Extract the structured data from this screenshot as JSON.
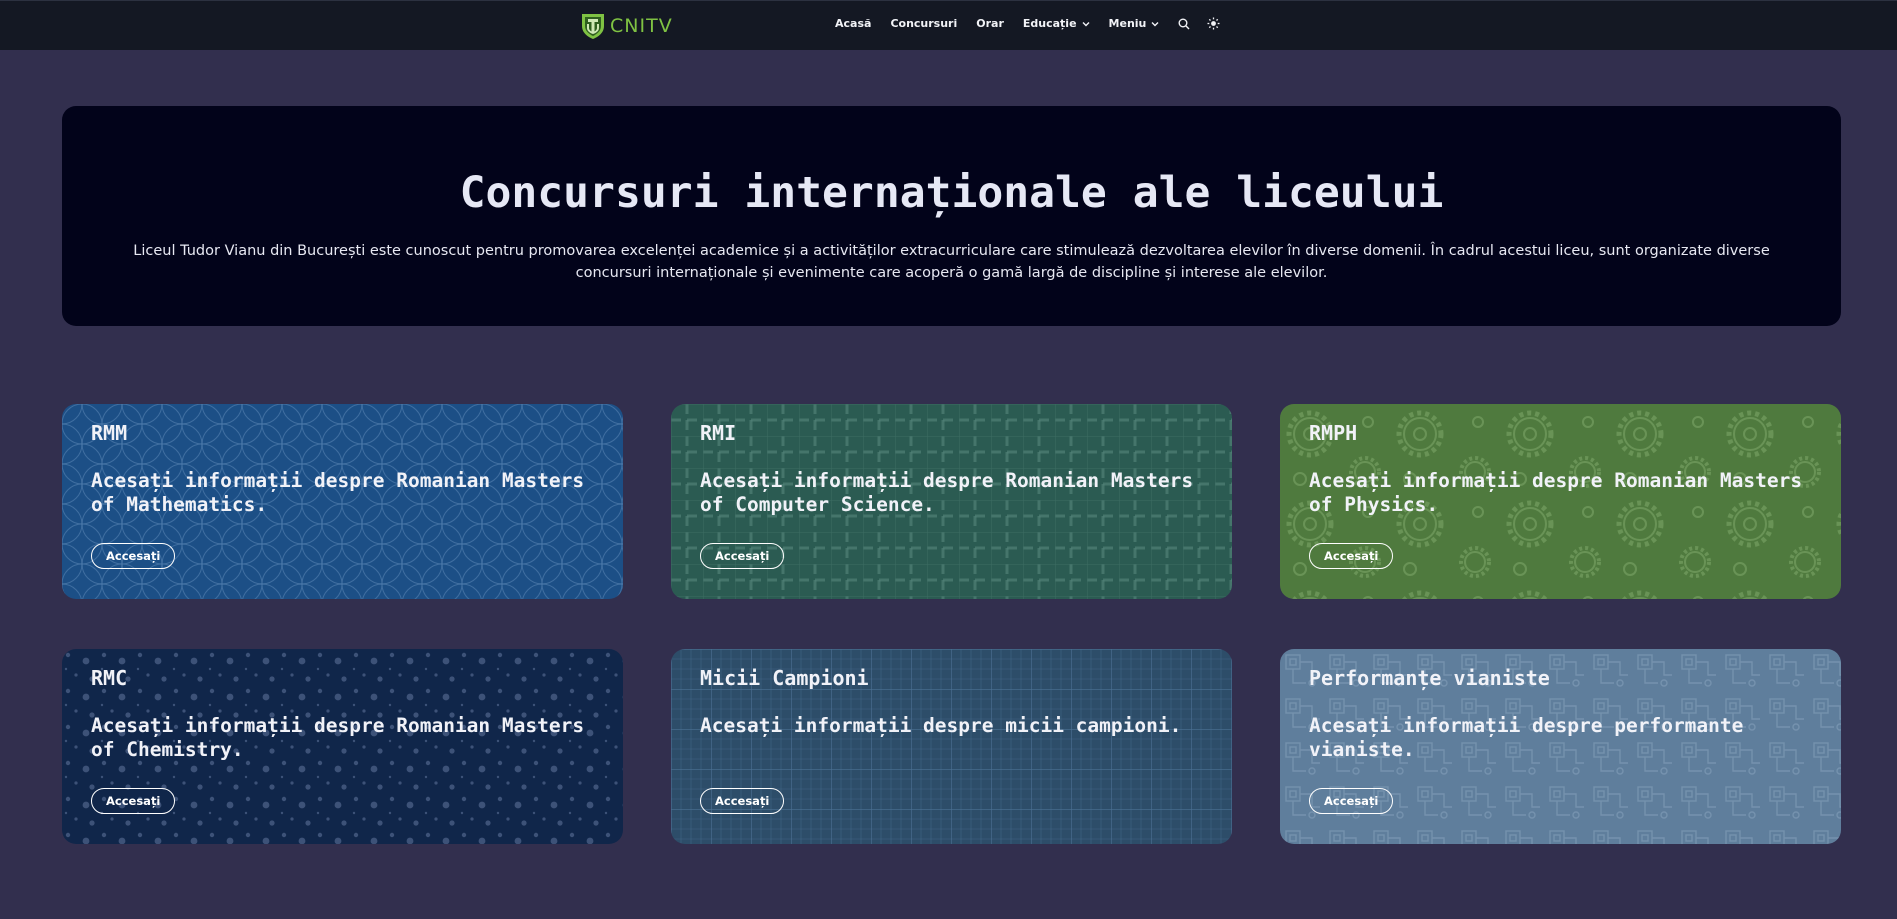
{
  "header": {
    "logo_text": "CNITV",
    "brand_color": "#7fc243",
    "nav": [
      {
        "label": "Acasă"
      },
      {
        "label": "Concursuri"
      },
      {
        "label": "Orar"
      },
      {
        "label": "Educație",
        "has_dropdown": true
      },
      {
        "label": "Meniu",
        "has_dropdown": true
      }
    ],
    "icons": [
      "search-icon",
      "theme-toggle-icon"
    ]
  },
  "hero": {
    "title": "Concursuri internaționale ale liceului",
    "description": "Liceul Tudor Vianu din București este cunoscut pentru promovarea excelenței academice și a activităților extracurriculare care stimulează dezvoltarea elevilor în diverse domenii. În cadrul acestui liceu, sunt organizate diverse concursuri internaționale și evenimente care acoperă o gamă largă de discipline și interese ale elevilor."
  },
  "cards": [
    {
      "title": "RMM",
      "description": "Acesați informații despre Romanian Masters of Mathematics.",
      "button": "Accesați",
      "color": "#1c4f86"
    },
    {
      "title": "RMI",
      "description": "Acesați informații despre Romanian Masters of Computer Science.",
      "button": "Accesați",
      "color": "#2b5b52"
    },
    {
      "title": "RMPH",
      "description": "Acesați informații despre Romanian Masters of Physics.",
      "button": "Accesați",
      "color": "#4f7a3e"
    },
    {
      "title": "RMC",
      "description": "Acesați informații despre Romanian Masters of Chemistry.",
      "button": "Accesați",
      "color": "#10264a"
    },
    {
      "title": "Micii Campioni",
      "description": "Acesați informații despre micii campioni.",
      "button": "Accesați",
      "color": "#2d4d69"
    },
    {
      "title": "Performanțe vianiste",
      "description": "Acesați informații despre performante vianiste.",
      "button": "Accesați",
      "color": "#5f7e9c"
    }
  ]
}
